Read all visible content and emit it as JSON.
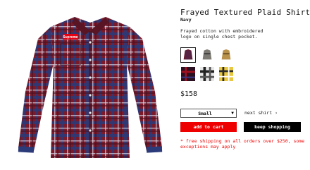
{
  "product": {
    "title": "Frayed Textured Plaid Shirt",
    "color_name": "Navy",
    "description": "Frayed cotton with embroidered logo on single chest pocket.",
    "price": "$158",
    "logo_text": "Supreme"
  },
  "swatches": [
    {
      "name": "navy",
      "selected": true
    },
    {
      "name": "grey",
      "selected": false
    },
    {
      "name": "tan",
      "selected": false
    },
    {
      "name": "red-black",
      "selected": false
    },
    {
      "name": "white-black",
      "selected": false
    },
    {
      "name": "yellow",
      "selected": false
    }
  ],
  "size_select": {
    "value": "Small",
    "icon": "caret-down-icon"
  },
  "next_link": "next shirt",
  "next_icon": "chevron-right-icon",
  "buttons": {
    "add_to_cart": "add to cart",
    "keep_shopping": "keep shopping"
  },
  "shipping_notice": "* free shipping on all orders over $250, some exceptions may apply",
  "colors": {
    "accent_red": "#ee0000",
    "button_black": "#000000"
  }
}
